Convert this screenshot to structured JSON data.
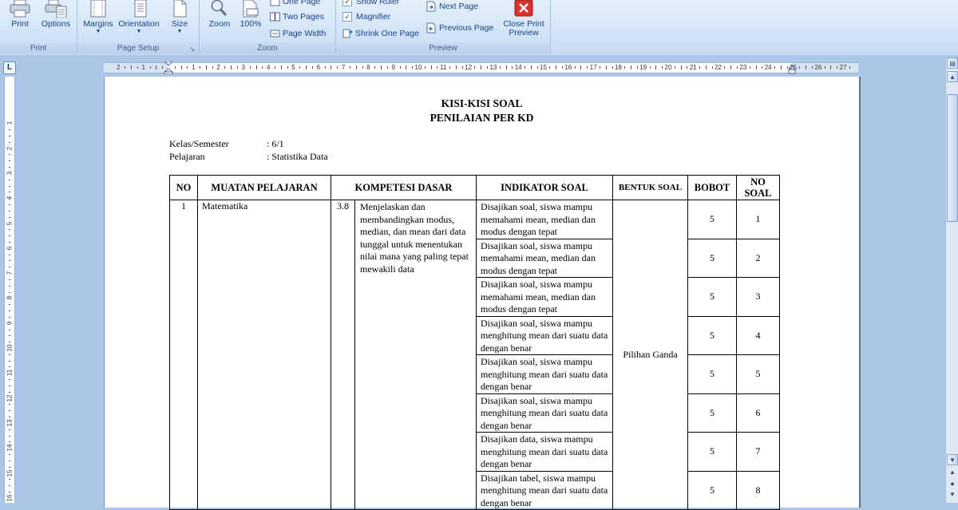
{
  "ribbon": {
    "groups": {
      "print": "Print",
      "page_setup": "Page Setup",
      "zoom": "Zoom",
      "preview": "Preview"
    },
    "buttons": {
      "print": "Print",
      "options": "Options",
      "margins": "Margins",
      "orientation": "Orientation",
      "size": "Size",
      "zoom": "Zoom",
      "zoom100": "100%",
      "one_page": "One Page",
      "two_pages": "Two Pages",
      "page_width": "Page Width",
      "show_ruler": "Show Ruler",
      "magnifier": "Magnifier",
      "shrink_one_page": "Shrink One Page",
      "next_page": "Next Page",
      "previous_page": "Previous Page",
      "close_line1": "Close Print",
      "close_line2": "Preview"
    },
    "show_ruler_checked": true,
    "magnifier_checked": true
  },
  "ruler_corner": "L",
  "document": {
    "title_line1": "KISI-KISI SOAL",
    "title_line2": "PENILAIAN PER KD",
    "kelas_label": "Kelas/Semester",
    "kelas_value": ": 6/1",
    "pelajaran_label": "Pelajaran",
    "pelajaran_value": ": Statistika Data",
    "table": {
      "headers": {
        "no": "NO",
        "muatan": "MUATAN PELAJARAN",
        "kd": "KOMPETESI DASAR",
        "indikator": "INDIKATOR SOAL",
        "bentuk": "BENTUK SOAL",
        "bobot": "BOBOT",
        "no_soal_1": "NO",
        "no_soal_2": "SOAL"
      },
      "no": "1",
      "muatan": "Matematika",
      "kd_number": "3.8",
      "kd_text": "Menjelaskan dan membandingkan modus, median, dan mean dari data tunggal untuk menentukan nilai mana yang paling tepat mewakili data",
      "bentuk": "Pilihan Ganda",
      "rows": [
        {
          "indikator": "Disajikan soal, siswa mampu memahami mean, median dan modus dengan tepat",
          "bobot": "5",
          "no_soal": "1"
        },
        {
          "indikator": "Disajikan soal, siswa mampu memahami mean, median dan modus dengan tepat",
          "bobot": "5",
          "no_soal": "2"
        },
        {
          "indikator": "Disajikan soal, siswa mampu memahami mean, median dan modus dengan tepat",
          "bobot": "5",
          "no_soal": "3"
        },
        {
          "indikator": "Disajikan soal, siswa mampu menghitung mean dari suatu data dengan benar",
          "bobot": "5",
          "no_soal": "4"
        },
        {
          "indikator": "Disajikan soal, siswa mampu menghitung mean dari suatu data dengan benar",
          "bobot": "5",
          "no_soal": "5"
        },
        {
          "indikator": "Disajikan soal, siswa mampu menghitung mean dari suatu data dengan benar",
          "bobot": "5",
          "no_soal": "6"
        },
        {
          "indikator": "Disajikan data, siswa mampu menghitung mean dari suatu data dengan benar",
          "bobot": "5",
          "no_soal": "7"
        },
        {
          "indikator": "Disajikan tabel, siswa mampu menghitung mean dari suatu data dengan benar",
          "bobot": "5",
          "no_soal": "8"
        }
      ]
    }
  },
  "colors": {
    "ribbon_text": "#15428b",
    "workspace": "#abc6e7",
    "close_icon": "#d9342b"
  }
}
